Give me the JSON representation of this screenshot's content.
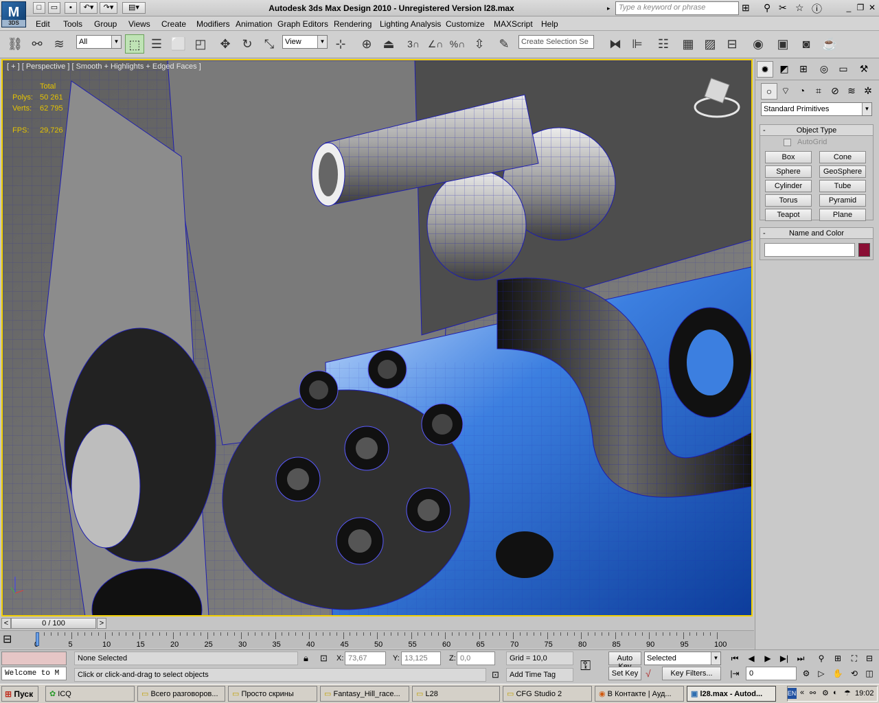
{
  "app": {
    "logo_text": "M",
    "logo_sub": "3DS",
    "title": "Autodesk 3ds Max Design 2010   -   Unregistered Version     l28.max",
    "search_placeholder": "Type a keyword or phrase"
  },
  "menu": [
    "Edit",
    "Tools",
    "Group",
    "Views",
    "Create",
    "Modifiers",
    "Animation",
    "Graph Editors",
    "Rendering",
    "Lighting Analysis",
    "Customize",
    "MAXScript",
    "Help"
  ],
  "toolbar": {
    "selection_filter": "All",
    "ref_coord": "View",
    "named_selection_placeholder": "Create Selection Se",
    "snap_3": "3",
    "angle_snap": "∠",
    "percent_snap": "%"
  },
  "viewport": {
    "label": "[ + ] [ Perspective ] [ Smooth + Highlights + Edged Faces ]",
    "stats_header": "Total",
    "polys_label": "Polys:",
    "polys_value": "50 261",
    "verts_label": "Verts:",
    "verts_value": "62 795",
    "fps_label": "FPS:",
    "fps_value": "29,726"
  },
  "command_panel": {
    "dropdown": "Standard Primitives",
    "object_type_title": "Object Type",
    "autogrid_label": "AutoGrid",
    "buttons": [
      "Box",
      "Cone",
      "Sphere",
      "GeoSphere",
      "Cylinder",
      "Tube",
      "Torus",
      "Pyramid",
      "Teapot",
      "Plane"
    ],
    "name_color_title": "Name and Color",
    "name_value": "",
    "swatch_color": "#8a0f35"
  },
  "timeline": {
    "slider_text": "0 / 100",
    "prev": "<",
    "next": ">",
    "ticks": [
      "0",
      "5",
      "10",
      "15",
      "20",
      "25",
      "30",
      "35",
      "40",
      "45",
      "50",
      "55",
      "60",
      "65",
      "70",
      "75",
      "80",
      "85",
      "90",
      "95",
      "100"
    ]
  },
  "status": {
    "listener": "Welcome to M",
    "selection": "None Selected",
    "prompt": "Click or click-and-drag to select objects",
    "x_label": "X:",
    "x_value": "73,67",
    "y_label": "Y:",
    "y_value": "13,125",
    "z_label": "Z:",
    "z_value": "0,0",
    "grid": "Grid = 10,0",
    "add_time_tag": "Add Time Tag",
    "auto_key": "Auto Key",
    "set_key": "Set Key",
    "key_mode": "Selected",
    "key_filters": "Key Filters...",
    "frame": "0"
  },
  "taskbar": {
    "start": "Пуск",
    "tasks": [
      "ICQ",
      "Всего разговоров...",
      "Просто скрины",
      "Fantasy_Hill_race...",
      "L28",
      "CFG Studio 2",
      "В Контакте | Ауд...",
      "l28.max - Autod..."
    ],
    "active_index": 7,
    "lang": "EN",
    "clock": "19:02"
  }
}
